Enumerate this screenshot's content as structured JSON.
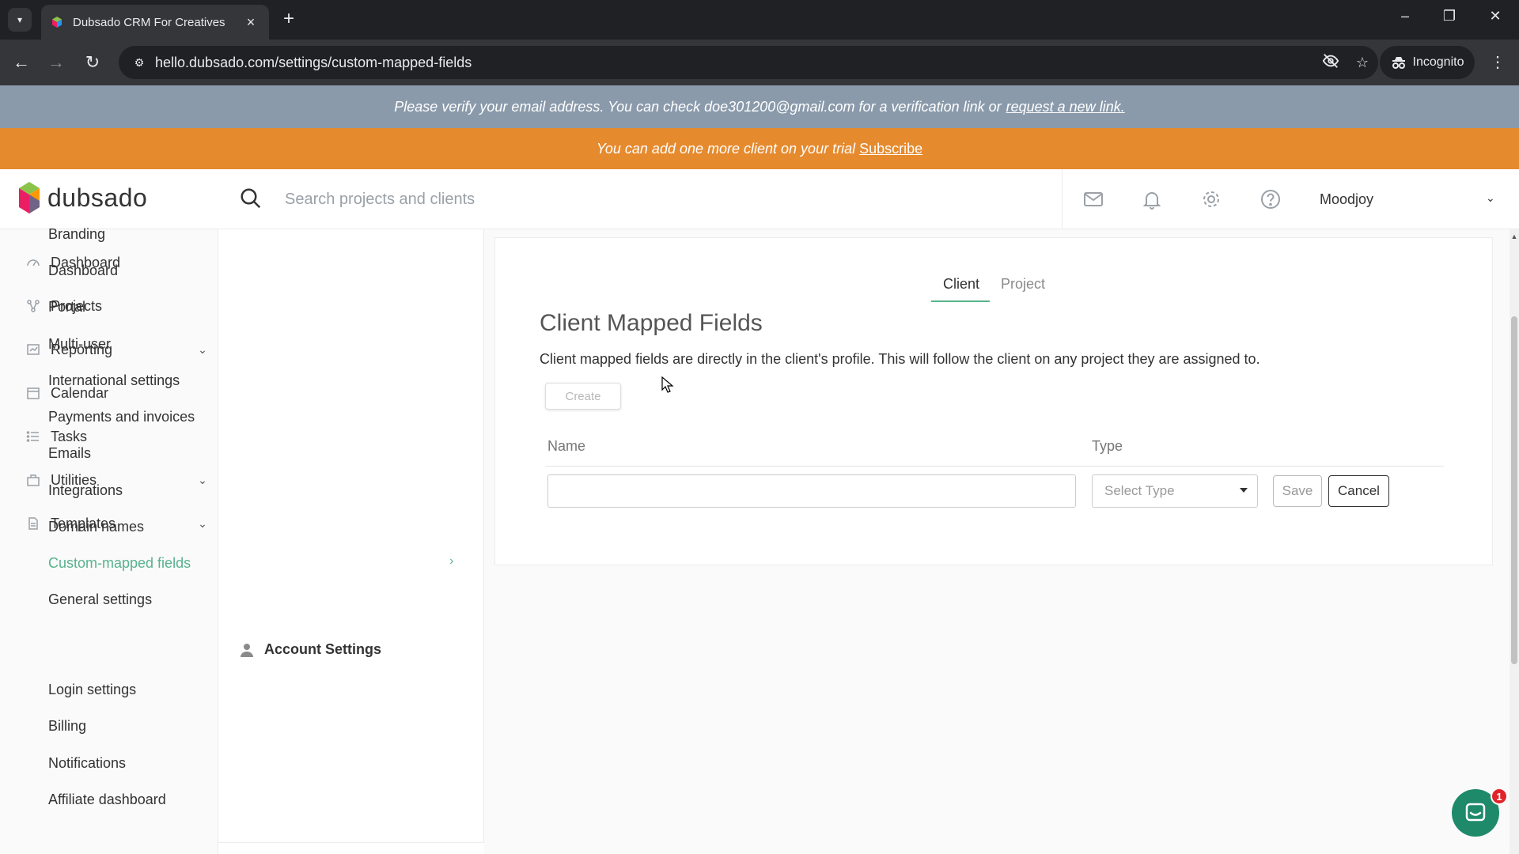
{
  "browser": {
    "tab_title": "Dubsado CRM For Creatives",
    "url": "hello.dubsado.com/settings/custom-mapped-fields",
    "incognito_label": "Incognito"
  },
  "banners": {
    "verify_text": "Please verify your email address. You can check doe301200@gmail.com for a verification link or",
    "verify_link": "request a new link.",
    "trial_text": "You can add one more client on your trial",
    "trial_link": "Subscribe"
  },
  "header": {
    "logo_text": "dubsado",
    "search_placeholder": "Search projects and clients",
    "user_name": "Moodjoy"
  },
  "leftnav": {
    "items": [
      {
        "label": "Dashboard",
        "icon": "dashboard-icon"
      },
      {
        "label": "Projects",
        "icon": "projects-icon"
      },
      {
        "label": "Reporting",
        "icon": "reporting-icon"
      },
      {
        "label": "Calendar",
        "icon": "calendar-icon"
      },
      {
        "label": "Tasks",
        "icon": "tasks-icon"
      },
      {
        "label": "Utilities",
        "icon": "utilities-icon"
      },
      {
        "label": "Templates",
        "icon": "templates-icon"
      }
    ]
  },
  "settings_nav": {
    "items": [
      "Branding",
      "Dashboard",
      "Portal",
      "Multi-user",
      "International settings",
      "Payments and invoices",
      "Emails",
      "Integrations",
      "Domain names",
      "Custom-mapped fields",
      "General settings"
    ],
    "active": "Custom-mapped fields",
    "account_heading": "Account Settings",
    "account_items": [
      "Login settings",
      "Billing",
      "Notifications",
      "Affiliate dashboard"
    ]
  },
  "main": {
    "tabs": [
      "Client",
      "Project"
    ],
    "active_tab": "Client",
    "title": "Client Mapped Fields",
    "description": "Client mapped fields are directly in the client's profile. This will follow the client on any project they are assigned to.",
    "create_label": "Create",
    "col_name": "Name",
    "col_type": "Type",
    "name_value": "",
    "type_placeholder": "Select Type",
    "save_label": "Save",
    "cancel_label": "Cancel"
  },
  "chat": {
    "badge_count": "1"
  },
  "colors": {
    "accent": "#57b38c",
    "trial_banner": "#e68a2e",
    "verify_banner": "#8a9aab",
    "chat": "#1e8a6a"
  }
}
